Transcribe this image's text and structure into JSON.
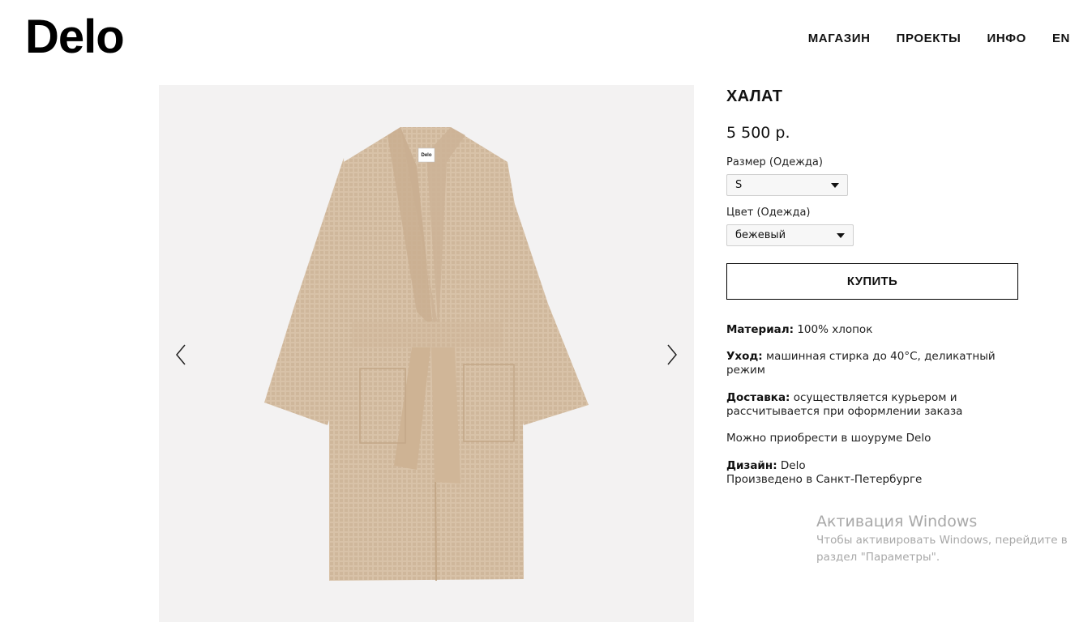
{
  "header": {
    "logo": "Delo",
    "nav": [
      {
        "label": "МАГАЗИН"
      },
      {
        "label": "ПРОЕКТЫ"
      },
      {
        "label": "ИНФО"
      },
      {
        "label": "EN"
      }
    ]
  },
  "gallery": {
    "image_label_text": "Delo",
    "prev_icon": "chevron-left-icon",
    "next_icon": "chevron-right-icon",
    "robe_color": "#d6bfa5"
  },
  "product": {
    "title": "ХАЛАТ",
    "price": "5 500 р.",
    "size_label": "Размер (Одежда)",
    "size_value": "S",
    "color_label": "Цвет (Одежда)",
    "color_value": "бежевый",
    "buy_label": "КУПИТЬ",
    "material_key": "Материал:",
    "material_value": " 100% хлопок",
    "care_key": "Уход:",
    "care_value": " машинная стирка до 40°C, деликатный режим",
    "delivery_key": "Доставка:",
    "delivery_value": " осуществляется курьером и рассчитывается при оформлении заказа",
    "showroom": "Можно приобрести в шоуруме Delo",
    "design_key": "Дизайн:",
    "design_value": " Delo",
    "made_in": "Произведено в Санкт-Петербурге"
  },
  "watermark": {
    "title": "Активация Windows",
    "line1": "Чтобы активировать Windows, перейдите в",
    "line2": "раздел \"Параметры\"."
  }
}
